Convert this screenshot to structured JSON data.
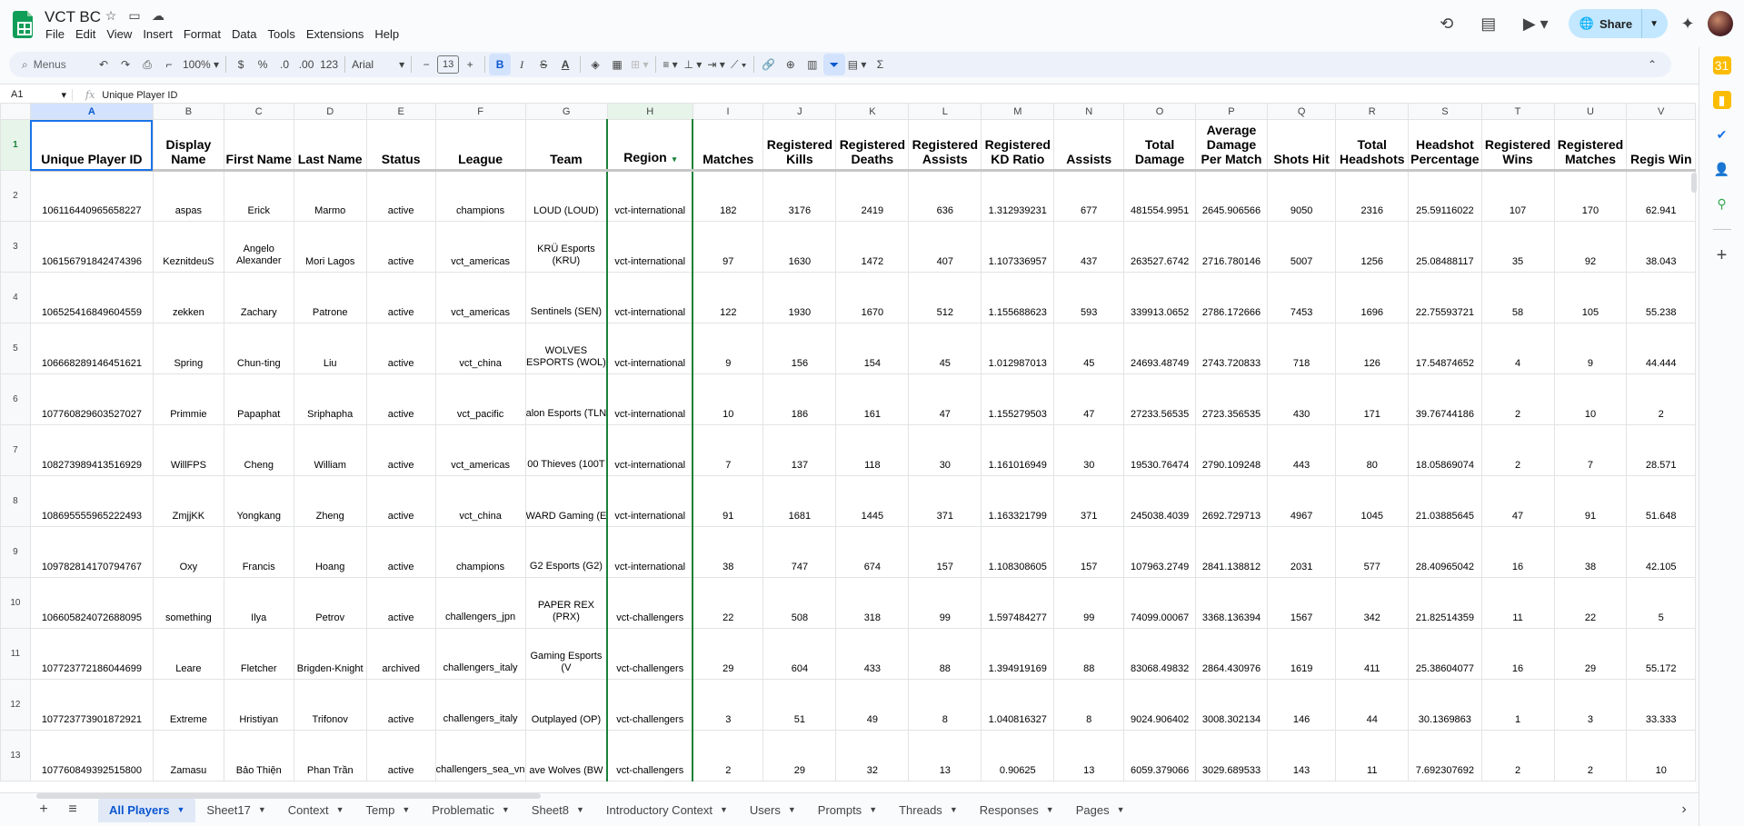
{
  "doc": {
    "title": "VCT BC"
  },
  "menu": [
    "File",
    "Edit",
    "View",
    "Insert",
    "Format",
    "Data",
    "Tools",
    "Extensions",
    "Help"
  ],
  "share_label": "Share",
  "toolbar": {
    "search": "Menus",
    "zoom": "100%",
    "currency": "$",
    "percent": "%",
    "dec_dec": ".0",
    "inc_dec": ".00",
    "more_formats": "123",
    "font": "Arial",
    "font_size": "13",
    "minus": "−",
    "plus": "+",
    "bold": "B",
    "italic": "I",
    "strike": "S",
    "text_color": "A",
    "sigma": "Σ"
  },
  "formula": {
    "cell": "A1",
    "content": "Unique Player ID"
  },
  "columns": [
    "A",
    "B",
    "C",
    "D",
    "E",
    "F",
    "G",
    "H",
    "I",
    "J",
    "K",
    "L",
    "M",
    "N",
    "O",
    "P",
    "Q",
    "R",
    "S",
    "T",
    "U",
    "V"
  ],
  "headers": [
    "Unique Player ID",
    "Display Name",
    "First Name",
    "Last Name",
    "Status",
    "League",
    "Team",
    "Region",
    "Matches",
    "Registered Kills",
    "Registered Deaths",
    "Registered Assists",
    "Registered KD Ratio",
    "Assists",
    "Total Damage",
    "Average Damage Per Match",
    "Shots Hit",
    "Total Headshots",
    "Headshot Percentage",
    "Registered Wins",
    "Registered Matches",
    "Regis Win"
  ],
  "rows": [
    {
      "n": "2",
      "c": [
        "106116440965658227",
        "aspas",
        "Erick",
        "Marmo",
        "active",
        "champions",
        "LOUD (LOUD)",
        "vct-international",
        "182",
        "3176",
        "2419",
        "636",
        "1.312939231",
        "677",
        "481554.9951",
        "2645.906566",
        "9050",
        "2316",
        "25.59116022",
        "107",
        "170",
        "62.941"
      ]
    },
    {
      "n": "3",
      "c": [
        "106156791842474396",
        "KeznitdeuS",
        "Angelo Alexander",
        "Mori Lagos",
        "active",
        "vct_americas",
        "KRÜ Esports (KRU)",
        "vct-international",
        "97",
        "1630",
        "1472",
        "407",
        "1.107336957",
        "437",
        "263527.6742",
        "2716.780146",
        "5007",
        "1256",
        "25.08488117",
        "35",
        "92",
        "38.043"
      ]
    },
    {
      "n": "4",
      "c": [
        "106525416849604559",
        "zekken",
        "Zachary",
        "Patrone",
        "active",
        "vct_americas",
        "Sentinels (SEN)",
        "vct-international",
        "122",
        "1930",
        "1670",
        "512",
        "1.155688623",
        "593",
        "339913.0652",
        "2786.172666",
        "7453",
        "1696",
        "22.75593721",
        "58",
        "105",
        "55.238"
      ]
    },
    {
      "n": "5",
      "c": [
        "106668289146451621",
        "Spring",
        "Chun-ting",
        "Liu",
        "active",
        "vct_china",
        "WOLVES ESPORTS (WOL)",
        "vct-international",
        "9",
        "156",
        "154",
        "45",
        "1.012987013",
        "45",
        "24693.48749",
        "2743.720833",
        "718",
        "126",
        "17.54874652",
        "4",
        "9",
        "44.444"
      ]
    },
    {
      "n": "6",
      "c": [
        "107760829603527027",
        "Primmie",
        "Papaphat",
        "Sriphapha",
        "active",
        "vct_pacific",
        "alon Esports (TLN",
        "vct-international",
        "10",
        "186",
        "161",
        "47",
        "1.155279503",
        "47",
        "27233.56535",
        "2723.356535",
        "430",
        "171",
        "39.76744186",
        "2",
        "10",
        "2"
      ]
    },
    {
      "n": "7",
      "c": [
        "108273989413516929",
        "WillFPS",
        "Cheng",
        "William",
        "active",
        "vct_americas",
        "00 Thieves (100T",
        "vct-international",
        "7",
        "137",
        "118",
        "30",
        "1.161016949",
        "30",
        "19530.76474",
        "2790.109248",
        "443",
        "80",
        "18.05869074",
        "2",
        "7",
        "28.571"
      ]
    },
    {
      "n": "8",
      "c": [
        "108695555965222493",
        "ZmjjKK",
        "Yongkang",
        "Zheng",
        "active",
        "vct_china",
        "WARD Gaming (E",
        "vct-international",
        "91",
        "1681",
        "1445",
        "371",
        "1.163321799",
        "371",
        "245038.4039",
        "2692.729713",
        "4967",
        "1045",
        "21.03885645",
        "47",
        "91",
        "51.648"
      ]
    },
    {
      "n": "9",
      "c": [
        "109782814170794767",
        "Oxy",
        "Francis",
        "Hoang",
        "active",
        "champions",
        "G2 Esports (G2)",
        "vct-international",
        "38",
        "747",
        "674",
        "157",
        "1.108308605",
        "157",
        "107963.2749",
        "2841.138812",
        "2031",
        "577",
        "28.40965042",
        "16",
        "38",
        "42.105"
      ]
    },
    {
      "n": "10",
      "c": [
        "106605824072688095",
        "something",
        "Ilya",
        "Petrov",
        "active",
        "challengers_jpn",
        "PAPER REX (PRX)",
        "vct-challengers",
        "22",
        "508",
        "318",
        "99",
        "1.597484277",
        "99",
        "74099.00067",
        "3368.136394",
        "1567",
        "342",
        "21.82514359",
        "11",
        "22",
        "5"
      ]
    },
    {
      "n": "11",
      "c": [
        "107723772186044699",
        "Leare",
        "Fletcher",
        "Brigden-Knight",
        "archived",
        "challengers_italy",
        "Gaming Esports (V",
        "vct-challengers",
        "29",
        "604",
        "433",
        "88",
        "1.394919169",
        "88",
        "83068.49832",
        "2864.430976",
        "1619",
        "411",
        "25.38604077",
        "16",
        "29",
        "55.172"
      ]
    },
    {
      "n": "12",
      "c": [
        "107723773901872921",
        "Extreme",
        "Hristiyan",
        "Trifonov",
        "active",
        "challengers_italy",
        "Outplayed (OP)",
        "vct-challengers",
        "3",
        "51",
        "49",
        "8",
        "1.040816327",
        "8",
        "9024.906402",
        "3008.302134",
        "146",
        "44",
        "30.1369863",
        "1",
        "3",
        "33.333"
      ]
    },
    {
      "n": "13",
      "c": [
        "107760849392515800",
        "Zamasu",
        "Bảo Thiện",
        "Phan Trần",
        "active",
        "challengers_sea_vn",
        "ave Wolves (BW",
        "vct-challengers",
        "2",
        "29",
        "32",
        "13",
        "0.90625",
        "13",
        "6059.379066",
        "3029.689533",
        "143",
        "11",
        "7.692307692",
        "2",
        "2",
        "10"
      ]
    }
  ],
  "sheet_tabs": [
    "All Players",
    "Sheet17",
    "Context",
    "Temp",
    "Problematic",
    "Sheet8",
    "Introductory Context",
    "Users",
    "Prompts",
    "Threads",
    "Responses",
    "Pages"
  ],
  "colors": {
    "accent": "#0b57d0",
    "share_bg": "#c2e7ff",
    "sheets_green": "#188038"
  }
}
